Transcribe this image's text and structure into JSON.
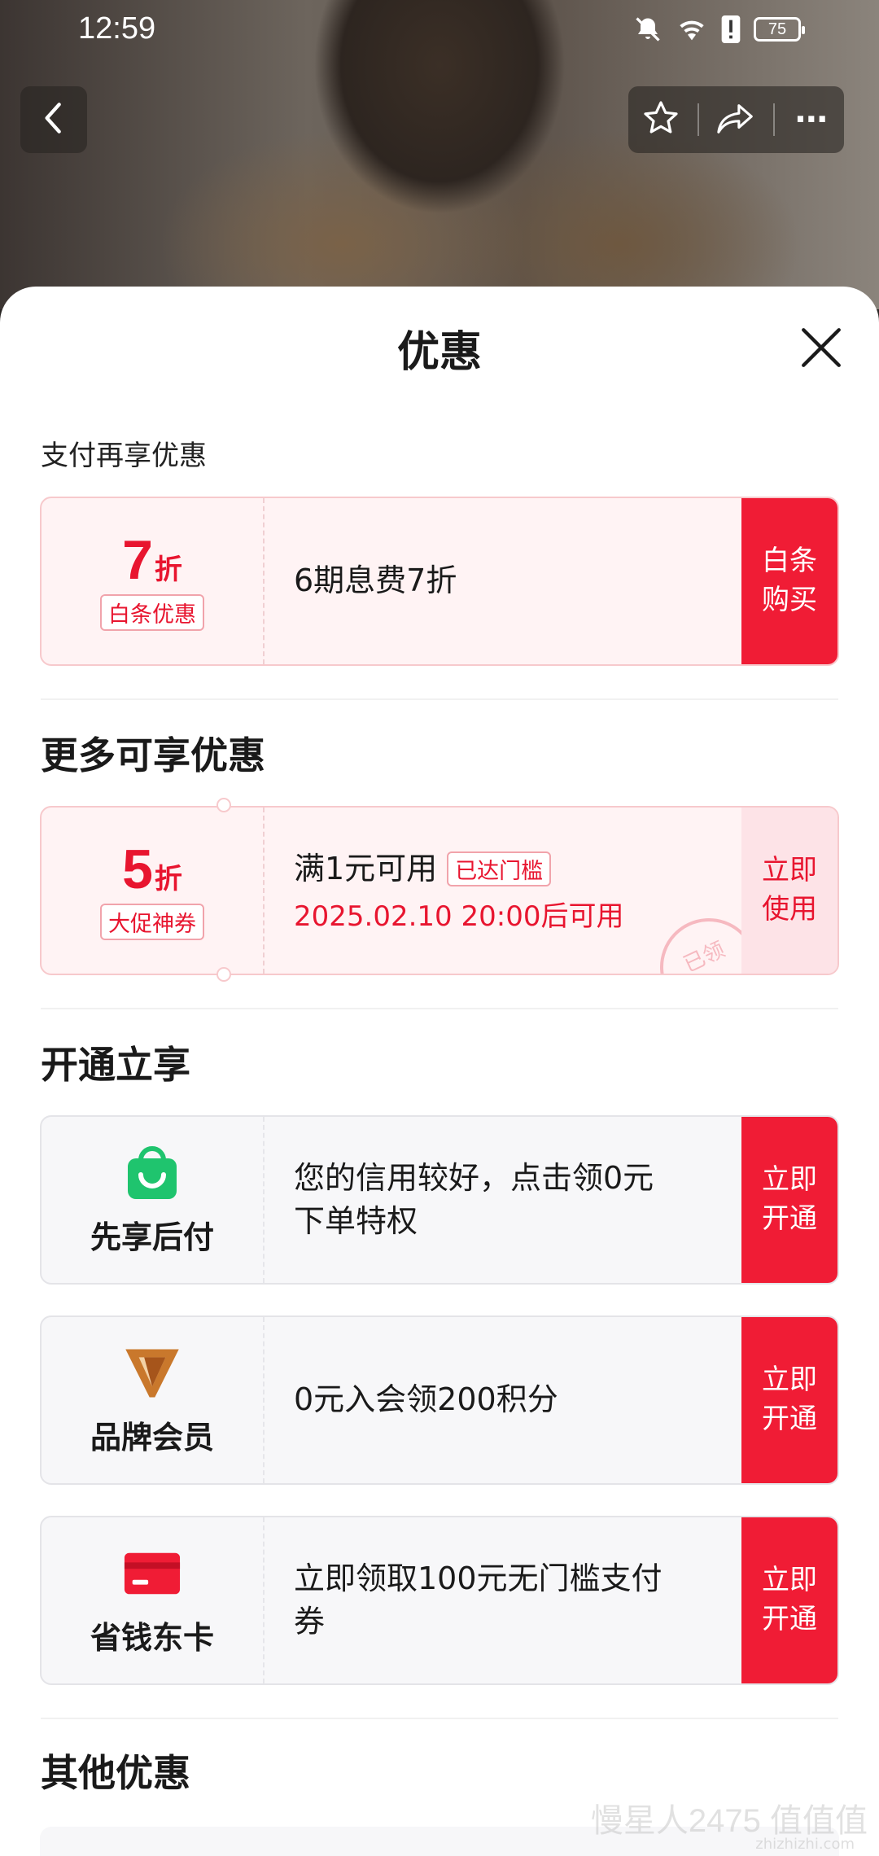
{
  "status_bar": {
    "time": "12:59",
    "battery": "75"
  },
  "nav": {
    "back_icon": "chevron-left-icon",
    "star_icon": "star-icon",
    "share_icon": "share-icon",
    "more_icon": "more-icon",
    "more_glyph": "⋯"
  },
  "sheet": {
    "title": "优惠",
    "close_icon": "close-icon"
  },
  "section_pay": {
    "title": "支付再享优惠",
    "card": {
      "discount_num": "7",
      "discount_unit": "折",
      "tag": "白条优惠",
      "text": "6期息费7折",
      "action_line1": "白条",
      "action_line2": "购买"
    }
  },
  "section_more": {
    "title": "更多可享优惠",
    "card": {
      "discount_num": "5",
      "discount_unit": "折",
      "tag": "大促神券",
      "text": "满1元可用",
      "status_tag": "已达门槛",
      "date": "2025.02.10 20:00后可用",
      "stamp": "已领",
      "action_line1": "立即",
      "action_line2": "使用"
    }
  },
  "section_open": {
    "title": "开通立享",
    "items": [
      {
        "icon": "shopping-bag-icon",
        "name": "先享后付",
        "text_line1": "您的信用较好，点击领0元",
        "text_line2": "下单特权",
        "action_line1": "立即",
        "action_line2": "开通"
      },
      {
        "icon": "brand-v-icon",
        "name": "品牌会员",
        "text_line1": "0元入会领200积分",
        "text_line2": "",
        "action_line1": "立即",
        "action_line2": "开通"
      },
      {
        "icon": "card-icon",
        "name": "省钱东卡",
        "text_line1": "立即领取100元无门槛支付",
        "text_line2": "券",
        "action_line1": "立即",
        "action_line2": "开通"
      }
    ]
  },
  "section_other": {
    "title": "其他优惠"
  },
  "watermark": {
    "main": "慢星人2475 值值值",
    "sub": "zhizhizhi.com"
  },
  "colors": {
    "accent": "#f01c35",
    "discount": "#e8152f",
    "green": "#1fc46e",
    "brand_orange": "#c9782c"
  }
}
